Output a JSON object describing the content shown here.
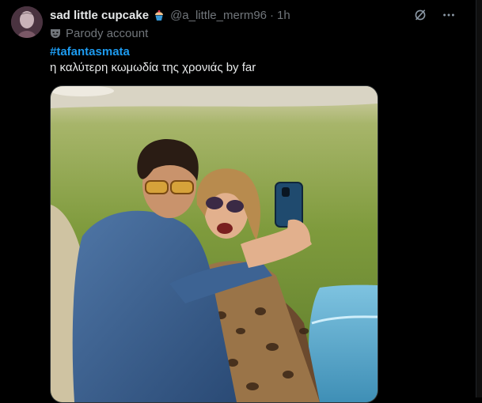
{
  "post": {
    "author": {
      "display_name": "sad little cupcake",
      "handle": "@a_little_merm96",
      "separator": "·",
      "time": "1h"
    },
    "parody_label": "Parody account",
    "hashtag": "#tafantasmata",
    "text": "η καλύτερη κωμωδία της χρονιάς by far",
    "icons": {
      "grok": "grok-icon",
      "more": "more-options-icon",
      "parody": "mask-icon",
      "emoji": "cupcake-icon"
    }
  },
  "colors": {
    "background": "#000000",
    "text_primary": "#e7e9ea",
    "text_secondary": "#71767b",
    "link": "#1d9bf0"
  }
}
